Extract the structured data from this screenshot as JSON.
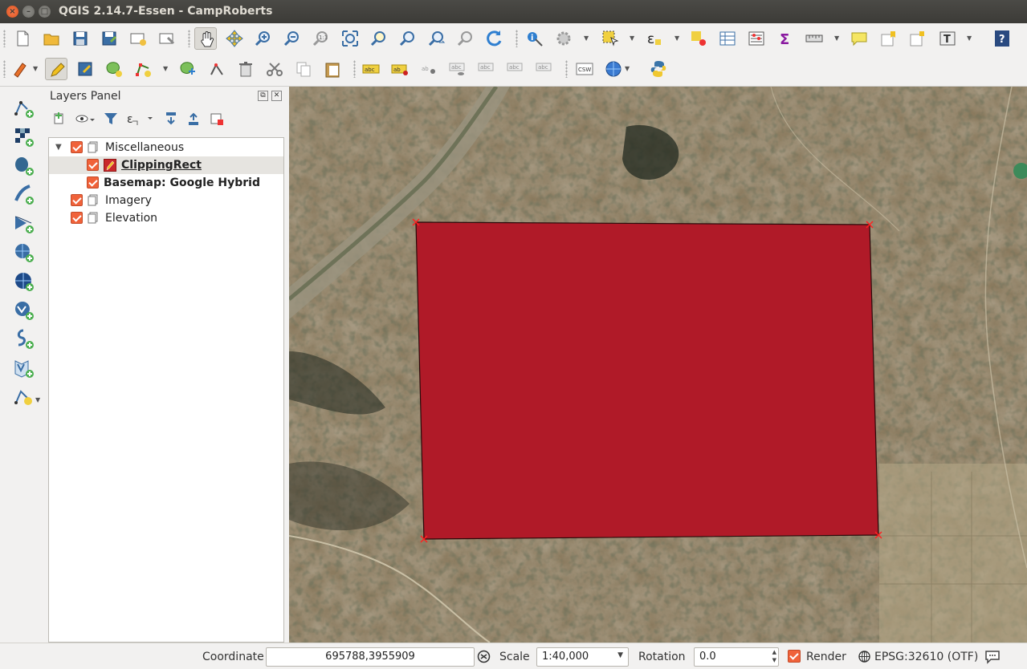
{
  "window": {
    "title": "QGIS 2.14.7-Essen - CampRoberts",
    "close_glyph": "×",
    "min_glyph": "–",
    "max_glyph": "□"
  },
  "toolbar_icons": {
    "row1": [
      "new-project-icon",
      "open-project-icon",
      "save-project-icon",
      "save-as-icon",
      "new-print-composer-icon",
      "composer-manager-icon",
      "pan-map-icon",
      "pan-to-selection-icon",
      "zoom-in-icon",
      "zoom-out-icon",
      "zoom-actual-size-icon",
      "zoom-full-icon",
      "zoom-to-selection-icon",
      "zoom-to-layer-icon",
      "zoom-last-icon",
      "zoom-next-icon",
      "refresh-icon",
      "identify-icon",
      "run-feature-action-icon",
      "select-features-icon",
      "select-by-expression-icon",
      "deselect-all-icon",
      "open-attribute-table-icon",
      "statistical-summary-icon",
      "field-calculator-icon",
      "measure-line-icon",
      "map-tips-icon",
      "new-bookmark-icon",
      "show-bookmarks-icon",
      "text-annotation-icon",
      "help-icon"
    ],
    "row2": [
      "current-edits-icon",
      "toggle-editing-icon",
      "save-layer-edits-icon",
      "add-feature-icon",
      "move-feature-icon",
      "node-tool-icon",
      "delete-selected-icon",
      "cut-features-icon",
      "copy-features-icon",
      "paste-features-icon",
      "label-tool-icon",
      "highlight-pinned-labels-icon",
      "pin-labels-icon",
      "show-hide-labels-icon",
      "move-label-icon",
      "rotate-label-icon",
      "change-label-icon",
      "csw-icon",
      "metasearch-icon",
      "python-console-icon"
    ]
  },
  "left_toolbar": [
    "add-vector-layer-icon",
    "add-raster-layer-icon",
    "add-postgis-layer-icon",
    "add-spatialite-layer-icon",
    "add-mssql-layer-icon",
    "add-wms-layer-icon",
    "add-wcs-layer-icon",
    "add-wfs-layer-icon",
    "add-delimited-text-icon",
    "add-virtual-layer-icon",
    "new-shapefile-layer-icon"
  ],
  "layers_panel": {
    "title": "Layers Panel",
    "float_glyph": "⧉",
    "close_glyph": "✕",
    "tools": [
      "add-group-icon",
      "manage-visibility-icon",
      "filter-legend-icon",
      "filter-by-expression-icon",
      "expand-all-icon",
      "collapse-all-icon",
      "remove-layer-icon"
    ],
    "layers": [
      {
        "name": "Miscellaneous",
        "type": "group",
        "expanded": true,
        "checked": true
      },
      {
        "name": "ClippingRect",
        "type": "vector",
        "checked": true,
        "selected": true,
        "editing": true
      },
      {
        "name": "Basemap: Google Hybrid",
        "type": "raster",
        "checked": true
      },
      {
        "name": "Imagery",
        "type": "group",
        "expanded": false,
        "checked": true
      },
      {
        "name": "Elevation",
        "type": "group",
        "expanded": false,
        "checked": true
      }
    ]
  },
  "map": {
    "polygon_fill": "#b01a28",
    "polygon_stroke": "#2a0a0a",
    "vertex_color": "#ff2020"
  },
  "statusbar": {
    "coordinate_label": "Coordinate",
    "coordinate_value": "695788,3955909",
    "scale_label": "Scale",
    "scale_value": "1:40,000",
    "rotation_label": "Rotation",
    "rotation_value": "0.0",
    "render_label": "Render",
    "render_checked": true,
    "crs_label": "EPSG:32610 (OTF)"
  }
}
